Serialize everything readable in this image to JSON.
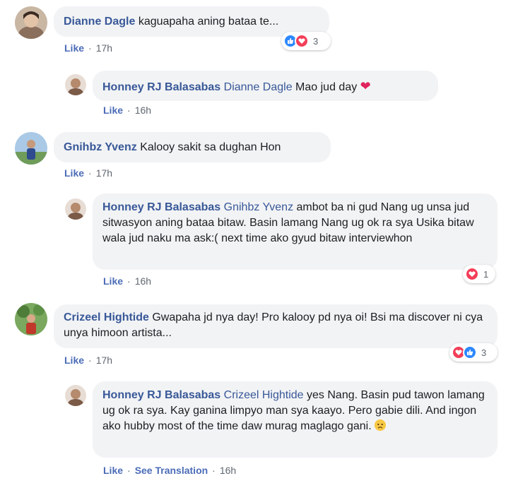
{
  "comments": [
    {
      "author": "Dianne Dagle",
      "text": "kaguapaha aning bataa te...",
      "meta": {
        "like": "Like",
        "time": "17h"
      },
      "reactions": {
        "icons": [
          "like-icon",
          "love-icon"
        ],
        "count": "3"
      },
      "reply": {
        "author": "Honney RJ Balasabas",
        "mention": "Dianne Dagle",
        "text": "Mao jud day",
        "emoji": "❤",
        "meta": {
          "like": "Like",
          "time": "16h"
        }
      }
    },
    {
      "author": "Gnihbz Yvenz",
      "text": "Kalooy sakit sa dughan Hon",
      "meta": {
        "like": "Like",
        "time": "17h"
      },
      "reply": {
        "author": "Honney RJ Balasabas",
        "mention": "Gnihbz Yvenz",
        "text": "ambot ba ni gud Nang ug unsa jud sitwasyon aning bataa bitaw. Basin lamang Nang ug ok ra sya Usika bitaw wala jud naku ma ask:( next time ako gyud bitaw interviewhon",
        "meta": {
          "like": "Like",
          "time": "16h"
        },
        "reactions": {
          "icons": [
            "love-icon"
          ],
          "count": "1"
        }
      }
    },
    {
      "author": "Crizeel Hightide",
      "text": "Gwapaha jd nya day! Pro kalooy pd nya oi! Bsi ma discover ni cya unya himoon artista...",
      "meta": {
        "like": "Like",
        "time": "17h"
      },
      "reactions": {
        "icons": [
          "love-icon",
          "like-icon"
        ],
        "count": "3"
      },
      "reply": {
        "author": "Honney RJ Balasabas",
        "mention": "Crizeel Hightide",
        "text": "yes Nang. Basin pud tawon lamang ug ok ra sya. Kay ganina limpyo man sya kaayo. Pero gabie dili. And ingon ako hubby most of the time daw murag maglago gani.",
        "meta": {
          "like": "Like",
          "translate": "See Translation",
          "time": "16h"
        }
      }
    }
  ],
  "colors": {
    "link": "#385898",
    "bubble": "#f2f3f5",
    "meta": "#606770",
    "like": "#2d88ff",
    "love": "#f33e58"
  }
}
